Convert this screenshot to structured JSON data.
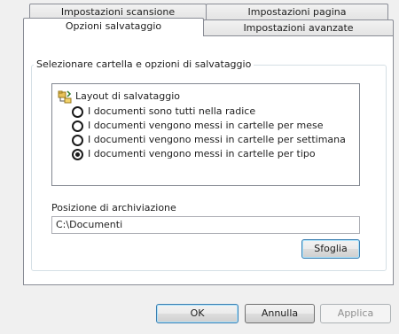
{
  "tabs": {
    "row_back": [
      "Impostazioni scansione",
      "Impostazioni pagina"
    ],
    "row_front": [
      "Opzioni salvataggio",
      "Impostazioni avanzate"
    ]
  },
  "group": {
    "legend": "Selezionare cartella e opzioni di salvataggio"
  },
  "layout": {
    "title": "Layout di salvataggio",
    "options": [
      {
        "label": "I documenti sono tutti nella radice",
        "selected": false
      },
      {
        "label": "I documenti vengono messi in cartelle per mese",
        "selected": false
      },
      {
        "label": "I documenti vengono messi in cartelle per settimana",
        "selected": false
      },
      {
        "label": "I documenti vengono messi in cartelle per tipo",
        "selected": true
      }
    ]
  },
  "archive": {
    "label": "Posizione di archiviazione",
    "path": "C:\\Documenti",
    "browse_label": "Sfoglia"
  },
  "footer": {
    "ok_label": "OK",
    "cancel_label": "Annulla",
    "apply_label": "Applica"
  },
  "icons": {
    "layout_folder": "folder-tree-icon"
  }
}
